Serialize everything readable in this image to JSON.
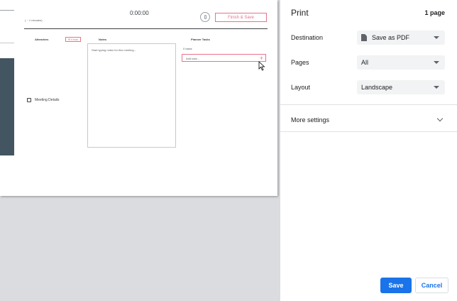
{
  "preview": {
    "timer": "0:00:00",
    "duration": "( ~ 1 minutes)",
    "finish_button": "Finish & Save",
    "attendees_header": "Attendees",
    "email_button": "Email",
    "notes_header": "Notes",
    "notes_placeholder": "Start typing notes for this meeting...",
    "tasks_header": "Planner Tasks",
    "tasks_count": "0 tasks",
    "add_task_placeholder": "Add task...",
    "meeting_details": "Meeting Details"
  },
  "print_panel": {
    "title": "Print",
    "page_count": "1 page",
    "destination_label": "Destination",
    "destination_value": "Save as PDF",
    "pages_label": "Pages",
    "pages_value": "All",
    "layout_label": "Layout",
    "layout_value": "Landscape",
    "more_settings": "More settings",
    "save_button": "Save",
    "cancel_button": "Cancel"
  },
  "colors": {
    "accent": "#1a73e8",
    "pink": "#e8738a",
    "sidebar_dark": "#435561"
  }
}
